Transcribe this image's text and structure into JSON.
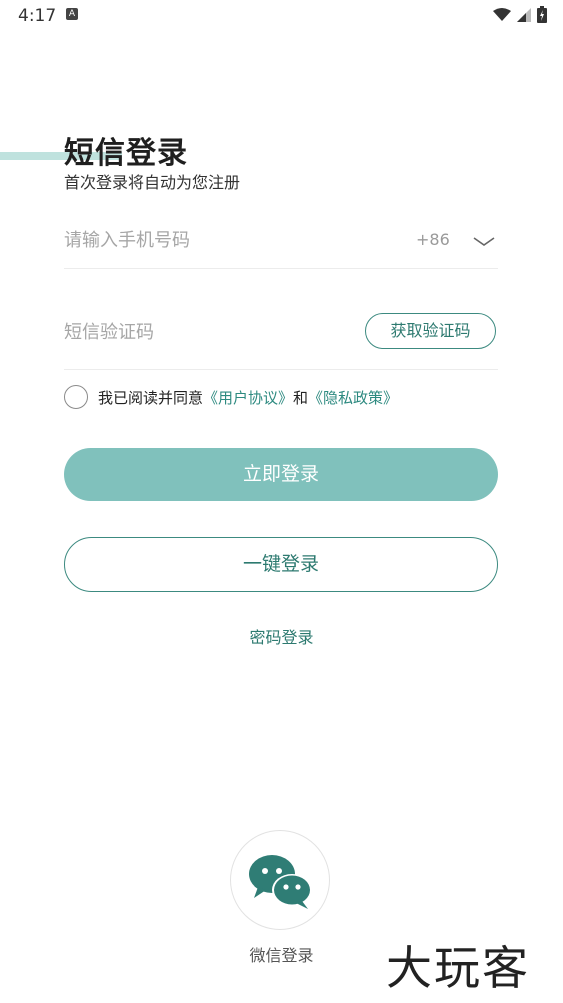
{
  "status_bar": {
    "time": "4:17",
    "indicator": "A"
  },
  "header": {
    "title": "短信登录",
    "subtitle": "首次登录将自动为您注册"
  },
  "phone": {
    "placeholder": "请输入手机号码",
    "country_code": "+86"
  },
  "sms": {
    "placeholder": "短信验证码",
    "get_code_label": "获取验证码"
  },
  "agreement": {
    "prefix": "我已阅读并同意",
    "user_agreement": "《用户协议》",
    "conjunction": "和",
    "privacy_policy": "《隐私政策》"
  },
  "actions": {
    "login_label": "立即登录",
    "one_key_label": "一键登录",
    "password_login_label": "密码登录"
  },
  "social": {
    "wechat_label": "微信登录"
  },
  "watermark": "大玩客",
  "colors": {
    "accent": "#3c8a80",
    "login_button": "#80c1bc",
    "title_highlight": "#bfe2de",
    "wechat_icon": "#2f7d75"
  }
}
